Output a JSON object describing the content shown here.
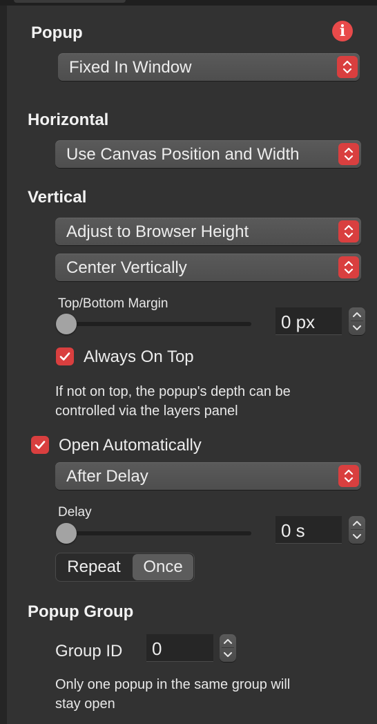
{
  "popup": {
    "heading": "Popup",
    "position_select": "Fixed In Window"
  },
  "horizontal": {
    "heading": "Horizontal",
    "select": "Use Canvas Position and Width"
  },
  "vertical": {
    "heading": "Vertical",
    "height_select": "Adjust to Browser Height",
    "align_select": "Center Vertically",
    "margin_label": "Top/Bottom Margin",
    "margin_value": "0 px",
    "always_on_top_label": "Always On Top",
    "always_on_top_checked": true,
    "help_line1": "If not on top, the popup's depth can be",
    "help_line2": "controlled via the layers panel"
  },
  "open": {
    "open_auto_label": "Open Automatically",
    "open_auto_checked": true,
    "trigger_select": "After Delay",
    "delay_label": "Delay",
    "delay_value": "0 s",
    "repeat_options": [
      "Repeat",
      "Once"
    ],
    "repeat_selected": "Once"
  },
  "group": {
    "heading": "Popup Group",
    "id_label": "Group ID",
    "id_value": "0",
    "help_line1": "Only one popup in the same group will",
    "help_line2": "stay open"
  },
  "colors": {
    "accent": "#d93f3f",
    "panel_bg": "#323232"
  },
  "icons": {
    "info": "info-icon",
    "select_arrows": "chevron-up-down-icon",
    "stepper": "stepper-arrows-icon",
    "checkmark": "checkmark-icon"
  }
}
